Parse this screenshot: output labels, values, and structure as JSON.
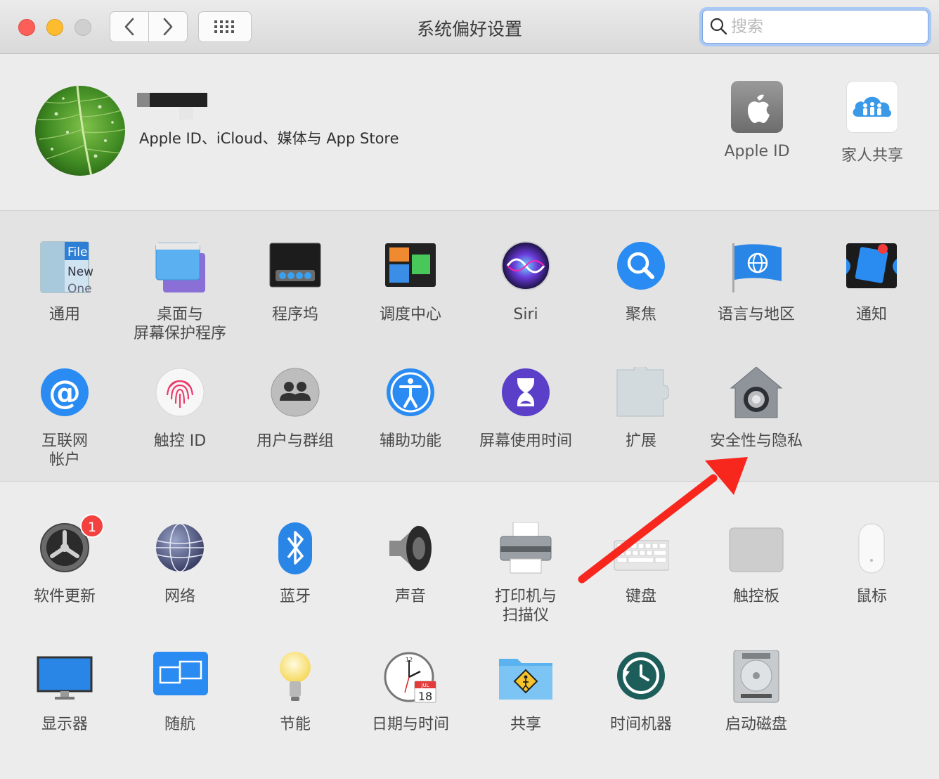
{
  "window": {
    "title": "系统偏好设置"
  },
  "search": {
    "placeholder": "搜索"
  },
  "account": {
    "subtitle": "Apple ID、iCloud、媒体与 App Store",
    "items": [
      {
        "label": "Apple ID",
        "icon": "apple-logo-icon"
      },
      {
        "label": "家人共享",
        "icon": "family-sharing-icon"
      }
    ]
  },
  "section1": {
    "row1": [
      {
        "label": "通用",
        "icon": "general-icon",
        "icon_text": [
          "File",
          "New",
          "One"
        ]
      },
      {
        "label": "桌面与\n屏幕保护程序",
        "icon": "desktop-screensaver-icon"
      },
      {
        "label": "程序坞",
        "icon": "dock-icon"
      },
      {
        "label": "调度中心",
        "icon": "mission-control-icon"
      },
      {
        "label": "Siri",
        "icon": "siri-icon"
      },
      {
        "label": "聚焦",
        "icon": "spotlight-icon"
      },
      {
        "label": "语言与地区",
        "icon": "language-region-icon"
      },
      {
        "label": "通知",
        "icon": "notifications-icon"
      }
    ],
    "row2": [
      {
        "label": "互联网\n帐户",
        "icon": "internet-accounts-icon",
        "icon_text": "@"
      },
      {
        "label": "触控 ID",
        "icon": "touch-id-icon"
      },
      {
        "label": "用户与群组",
        "icon": "users-groups-icon"
      },
      {
        "label": "辅助功能",
        "icon": "accessibility-icon"
      },
      {
        "label": "屏幕使用时间",
        "icon": "screen-time-icon"
      },
      {
        "label": "扩展",
        "icon": "extensions-icon"
      },
      {
        "label": "安全性与隐私",
        "icon": "security-privacy-icon"
      }
    ]
  },
  "section2": {
    "row1": [
      {
        "label": "软件更新",
        "icon": "software-update-icon",
        "badge": "1"
      },
      {
        "label": "网络",
        "icon": "network-icon"
      },
      {
        "label": "蓝牙",
        "icon": "bluetooth-icon"
      },
      {
        "label": "声音",
        "icon": "sound-icon"
      },
      {
        "label": "打印机与\n扫描仪",
        "icon": "printers-scanners-icon"
      },
      {
        "label": "键盘",
        "icon": "keyboard-icon"
      },
      {
        "label": "触控板",
        "icon": "trackpad-icon"
      },
      {
        "label": "鼠标",
        "icon": "mouse-icon"
      }
    ],
    "row2": [
      {
        "label": "显示器",
        "icon": "displays-icon"
      },
      {
        "label": "随航",
        "icon": "sidecar-icon"
      },
      {
        "label": "节能",
        "icon": "energy-saver-icon"
      },
      {
        "label": "日期与时间",
        "icon": "date-time-icon",
        "icon_text": [
          "12",
          "JUL",
          "18"
        ]
      },
      {
        "label": "共享",
        "icon": "sharing-icon"
      },
      {
        "label": "时间机器",
        "icon": "time-machine-icon"
      },
      {
        "label": "启动磁盘",
        "icon": "startup-disk-icon"
      }
    ]
  },
  "annotation": {
    "arrow_color": "#f7271d"
  }
}
